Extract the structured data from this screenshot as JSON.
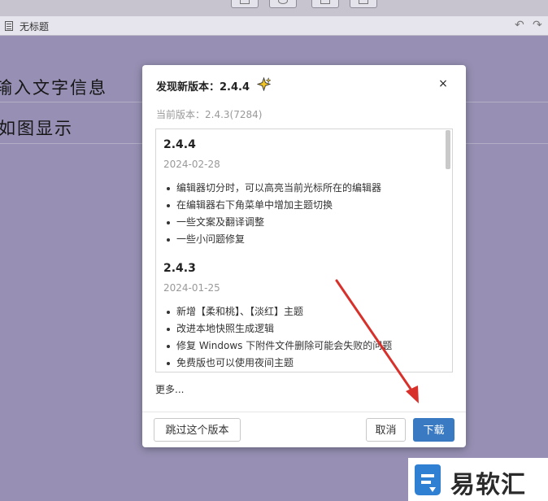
{
  "window": {
    "tab_title": "无标题",
    "undo_icon": "undo-icon",
    "redo_icon": "redo-icon"
  },
  "document": {
    "lines": [
      "输入文字信息",
      "如图显示"
    ]
  },
  "dialog": {
    "title": "发现新版本：2.4.4",
    "title_icon": "sparkle-icon",
    "close_label": "×",
    "current_version": "当前版本：2.4.3(7284)",
    "releases": [
      {
        "version": "2.4.4",
        "date": "2024-02-28",
        "items": [
          "编辑器切分时，可以高亮当前光标所在的编辑器",
          "在编辑器右下角菜单中增加主题切换",
          "一些文案及翻译调整",
          "一些小问题修复"
        ]
      },
      {
        "version": "2.4.3",
        "date": "2024-01-25",
        "items": [
          "新增【柔和桃】、【淡红】主题",
          "改进本地快照生成逻辑",
          "修复 Windows 下附件文件删除可能会失败的问题",
          "免费版也可以使用夜间主题"
        ]
      }
    ],
    "more_label": "更多...",
    "skip_label": "跳过这个版本",
    "cancel_label": "取消",
    "download_label": "下载"
  },
  "watermark": {
    "text": "易软汇"
  },
  "colors": {
    "background": "#9790b4",
    "accent": "#3a7ac2",
    "arrow": "#d8312b"
  }
}
